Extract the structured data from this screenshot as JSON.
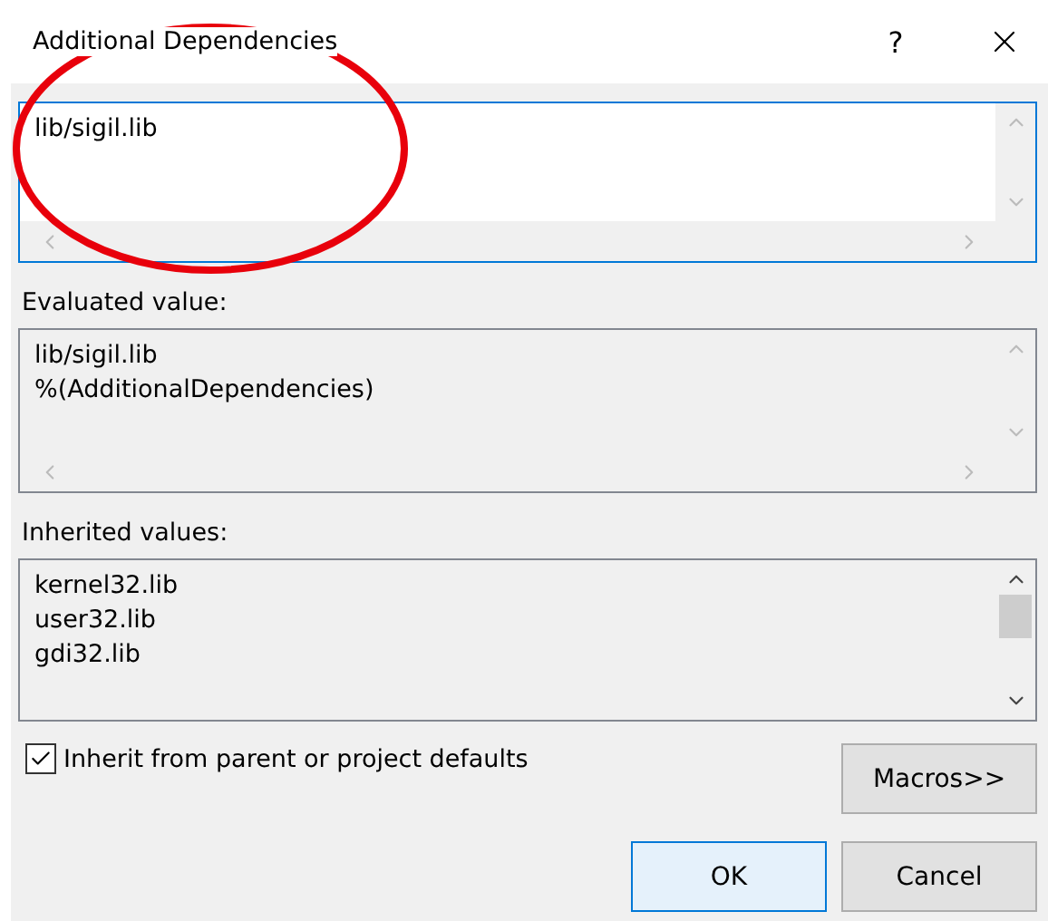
{
  "window": {
    "title": "Additional Dependencies",
    "help": "?"
  },
  "editor": {
    "lines": [
      "lib/sigil.lib"
    ],
    "focused": true
  },
  "evaluated": {
    "label": "Evaluated value:",
    "lines": [
      "lib/sigil.lib",
      "%(AdditionalDependencies)"
    ]
  },
  "inherited": {
    "label": "Inherited values:",
    "lines": [
      "kernel32.lib",
      "user32.lib",
      "gdi32.lib"
    ]
  },
  "inherit_checkbox": {
    "label": "Inherit from parent or project defaults",
    "checked": true
  },
  "buttons": [
    {
      "kind": "macros",
      "label": "Macros>>",
      "default": false
    },
    {
      "kind": "ok",
      "label": "OK",
      "default": true
    },
    {
      "kind": "cancel",
      "label": "Cancel",
      "default": false
    }
  ]
}
